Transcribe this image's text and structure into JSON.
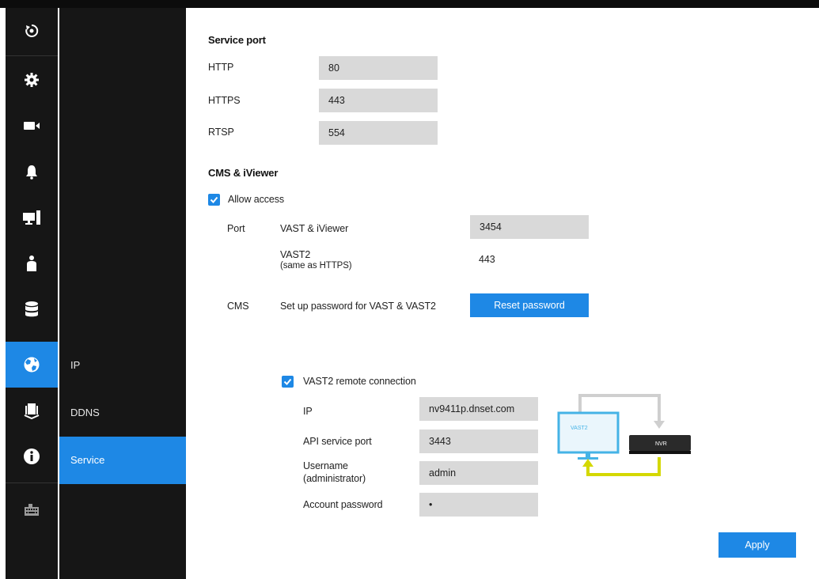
{
  "nav": {
    "icons": [
      "live-view-icon",
      "settings-gear-icon",
      "camera-icon",
      "alarm-bell-icon",
      "display-icon",
      "user-icon",
      "storage-icon",
      "network-globe-icon",
      "vast-connection-icon",
      "info-icon",
      "keyboard-icon"
    ],
    "active_icon": "network-globe-icon"
  },
  "submenu": {
    "items": [
      {
        "label": "IP"
      },
      {
        "label": "DDNS"
      },
      {
        "label": "Service"
      }
    ],
    "active": "Service"
  },
  "service_port": {
    "title": "Service port",
    "http": {
      "label": "HTTP",
      "value": "80"
    },
    "https": {
      "label": "HTTPS",
      "value": "443"
    },
    "rtsp": {
      "label": "RTSP",
      "value": "554"
    }
  },
  "cms": {
    "title": "CMS & iViewer",
    "allow_access": {
      "label": "Allow access",
      "checked": true
    },
    "port_label": "Port",
    "vast_iviewer": {
      "label": "VAST & iViewer",
      "value": "3454"
    },
    "vast2": {
      "label": "VAST2",
      "sublabel": "(same as HTTPS)",
      "value": "443"
    },
    "cms_label": "CMS",
    "password_text": "Set up password for VAST & VAST2",
    "reset_button": "Reset password"
  },
  "remote": {
    "checkbox": {
      "label": "VAST2 remote connection",
      "checked": true
    },
    "ip": {
      "label": "IP",
      "value": "nv9411p.dnset.com"
    },
    "api_port": {
      "label": "API service port",
      "value": "3443"
    },
    "username": {
      "label": "Username",
      "sublabel": "(administrator)",
      "value": "admin"
    },
    "password": {
      "label": "Account password",
      "value": "•"
    }
  },
  "diagram": {
    "monitor_label": "VAST2",
    "nvr_label": "NVR"
  },
  "apply_button": "Apply",
  "colors": {
    "accent": "#1e88e5",
    "sidebar": "#161616",
    "field": "#d9d9d9",
    "diagram_arrow_top": "#cfcfcf",
    "diagram_arrow_bottom": "#d4d800"
  }
}
